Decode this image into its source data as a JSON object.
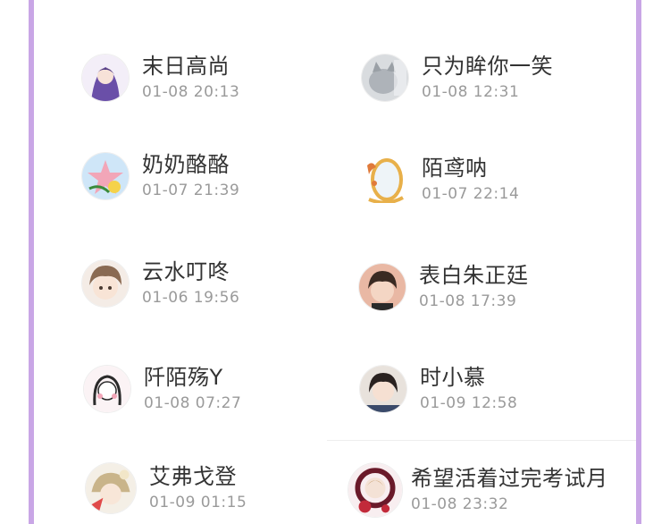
{
  "users": [
    {
      "name": "末日高尚",
      "time": "01-08 20:13",
      "avatar": "anime-purple-girl-icon",
      "color": "#6a4fa8"
    },
    {
      "name": "只为眸你一笑",
      "time": "01-08 12:31",
      "avatar": "grey-cat-icon",
      "color": "#b8bcc2"
    },
    {
      "name": "奶奶酪酪",
      "time": "01-07 21:39",
      "avatar": "cartoon-star-icon",
      "color": "#7ab8e8"
    },
    {
      "name": "陌鸢呐",
      "time": "01-07 22:14",
      "avatar": "mirror-sticker-icon",
      "color": "#e8b04a"
    },
    {
      "name": "云水叮咚",
      "time": "01-06 19:56",
      "avatar": "anime-boy-icon",
      "color": "#c99a7a"
    },
    {
      "name": "表白朱正廷",
      "time": "01-08 17:39",
      "avatar": "boy-portrait-icon",
      "color": "#d49a84"
    },
    {
      "name": "阡陌殇Y",
      "time": "01-08 07:27",
      "avatar": "sketch-girl-icon",
      "color": "#f2d4dc"
    },
    {
      "name": "时小慕",
      "time": "01-09 12:58",
      "avatar": "girl-portrait-icon",
      "color": "#8a6a52"
    },
    {
      "name": "艾弗戈登",
      "time": "01-09 01:15",
      "avatar": "anime-hat-girl-icon",
      "color": "#c9b48a"
    },
    {
      "name": "希望活着过完考试月",
      "time": "01-08 23:32",
      "avatar": "rose-frame-icon",
      "color": "#8a2a3a"
    }
  ]
}
